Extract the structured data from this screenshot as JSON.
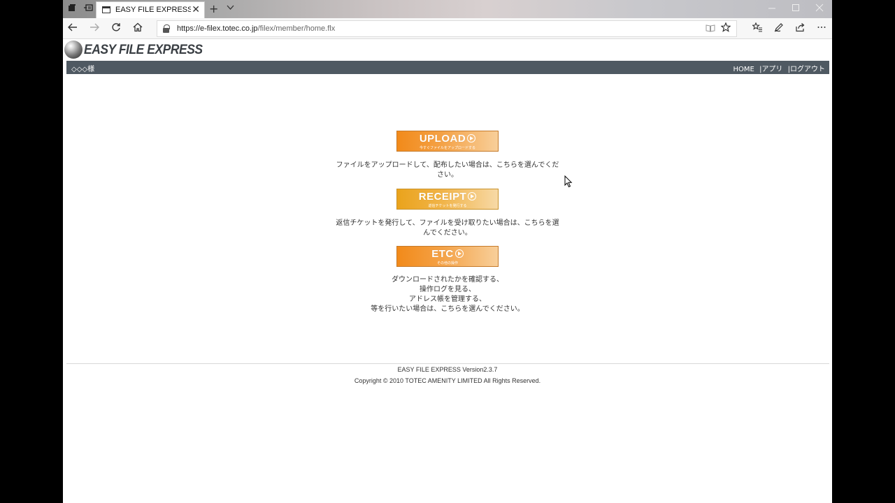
{
  "browser": {
    "tab_title": "EASY FILE EXPRESS_HOI",
    "url_host": "https://e-filex.totec.co.jp",
    "url_path": "/filex/member/home.flx",
    "icons": [
      "tab-actions-icon",
      "set-aside-tabs-icon",
      "tab-page-icon",
      "close-icon",
      "new-tab-icon",
      "tab-list-icon",
      "back-icon",
      "forward-icon",
      "refresh-icon",
      "home-icon",
      "lock-icon",
      "reading-view-icon",
      "favorite-star-icon",
      "favorites-hub-icon",
      "pen-icon",
      "share-icon",
      "more-icon"
    ]
  },
  "site": {
    "logo_text": "EASY FILE EXPRESS",
    "user_label": "◇◇◇様",
    "nav": {
      "home": "HOME",
      "sep1": "|",
      "apps": "アプリ",
      "sep2": "|",
      "logout": "ログアウト"
    }
  },
  "main": {
    "upload": {
      "label": "UPLOAD",
      "sub": "今すぐファイルをアップロードする",
      "desc": "ファイルをアップロードして、配布したい場合は、こちらを選んでください。"
    },
    "receipt": {
      "label": "RECEIPT",
      "sub": "返信チケットを発行する",
      "desc": "返信チケットを発行して、ファイルを受け取りたい場合は、こちらを選んでください。"
    },
    "etc": {
      "label": "ETC",
      "sub": "その他の操作",
      "desc_lines": [
        "ダウンロードされたかを確認する、",
        "操作ログを見る、",
        "アドレス帳を管理する、",
        "等を行いたい場合は、こちらを選んでください。"
      ]
    }
  },
  "footer": {
    "version": "EASY FILE EXPRESS Version2.3.7",
    "copyright": "Copyright © 2010 TOTEC AMENITY LIMITED All Rights Reserved."
  }
}
